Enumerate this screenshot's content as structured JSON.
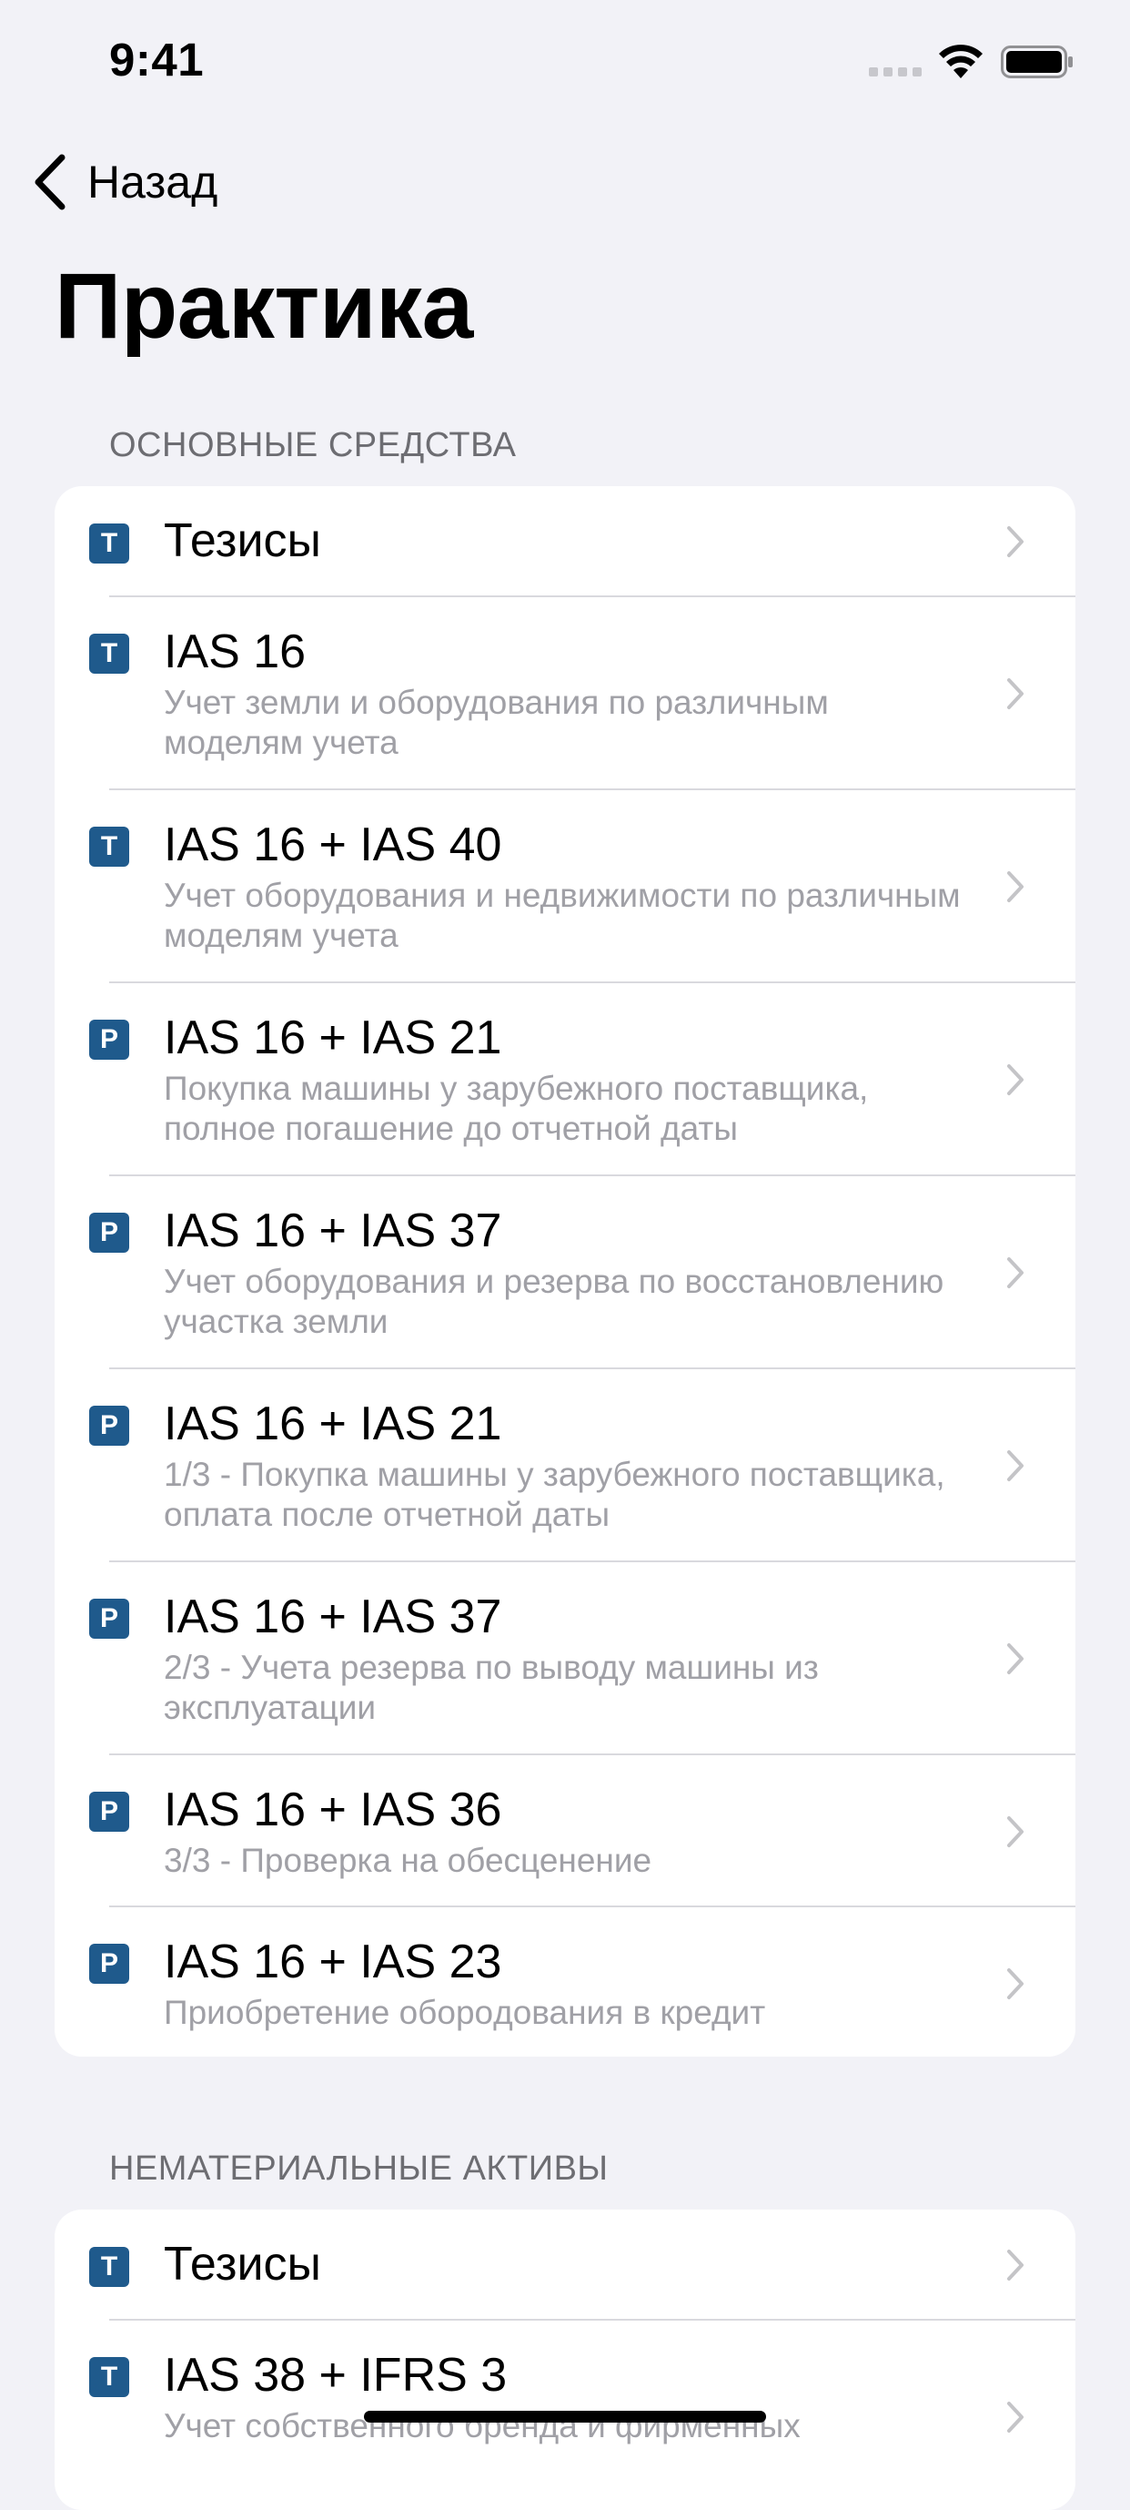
{
  "status": {
    "time": "9:41"
  },
  "nav": {
    "back_label": "Назад"
  },
  "page": {
    "title": "Практика"
  },
  "sections": [
    {
      "header": "ОСНОВНЫЕ СРЕДСТВА",
      "items": [
        {
          "badge": "T",
          "title": "Тезисы",
          "subtitle": ""
        },
        {
          "badge": "T",
          "title": "IAS 16",
          "subtitle": "Учет земли и оборудования по различным моделям учета"
        },
        {
          "badge": "T",
          "title": "IAS 16 + IAS 40",
          "subtitle": "Учет оборудования и недвижимости по различным моделям учета"
        },
        {
          "badge": "P",
          "title": "IAS 16 + IAS 21",
          "subtitle": "Покупка машины у зарубежного поставщика, полное погашение до отчетной даты"
        },
        {
          "badge": "P",
          "title": "IAS 16 + IAS 37",
          "subtitle": "Учет оборудования и резерва по восстановлению участка земли"
        },
        {
          "badge": "P",
          "title": "IAS 16 + IAS 21",
          "subtitle": "1/3 - Покупка машины у зарубежного поставщика, оплата после отчетной даты"
        },
        {
          "badge": "P",
          "title": "IAS 16 + IAS 37",
          "subtitle": "2/3 - Учета резерва по выводу машины из эксплуатации"
        },
        {
          "badge": "P",
          "title": "IAS 16 + IAS 36",
          "subtitle": "3/3 - Проверка на обесценение"
        },
        {
          "badge": "P",
          "title": "IAS 16 + IAS 23",
          "subtitle": "Приобретение оборoдования в кредит"
        }
      ]
    },
    {
      "header": "НЕМАТЕРИАЛЬНЫЕ АКТИВЫ",
      "items": [
        {
          "badge": "T",
          "title": "Тезисы",
          "subtitle": ""
        },
        {
          "badge": "T",
          "title": "IAS 38 + IFRS 3",
          "subtitle": "Учет собственного бренда и фирменных"
        }
      ]
    }
  ],
  "colors": {
    "badge": "#1f5a8c",
    "background": "#f2f2f7",
    "subtitle": "#a0a0a6"
  }
}
